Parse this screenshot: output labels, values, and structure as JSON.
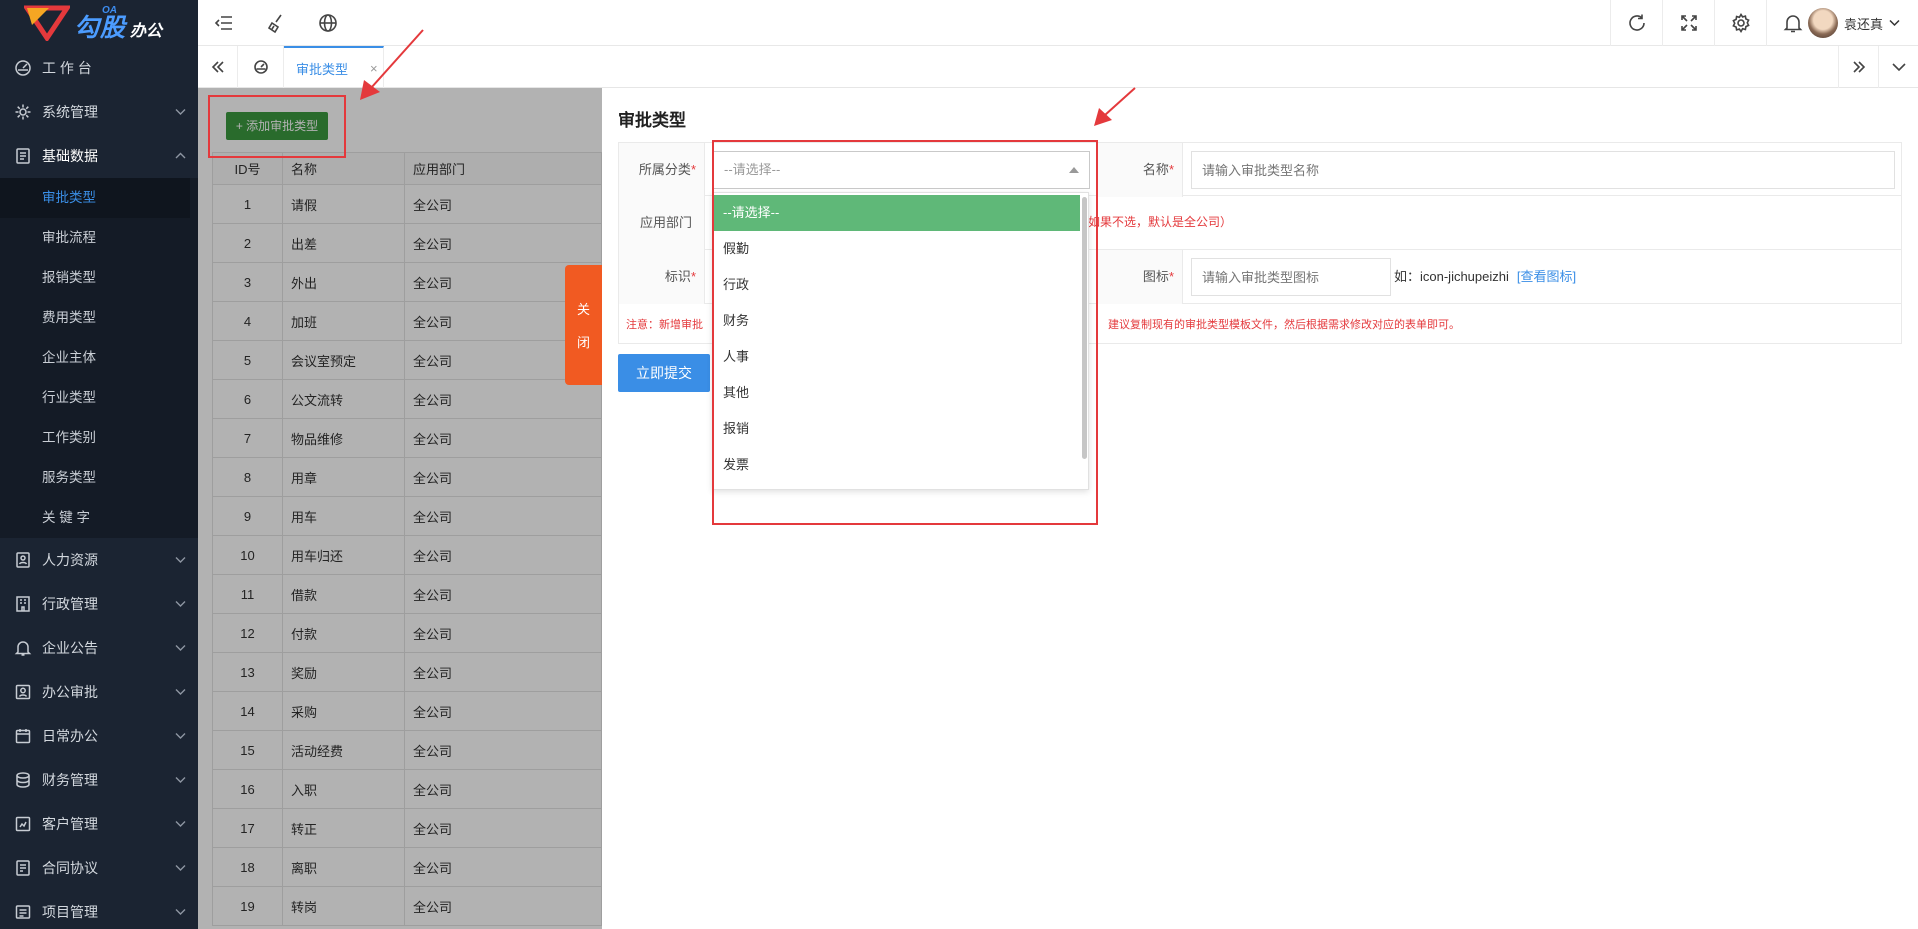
{
  "logo": {
    "oa": "OA",
    "brand": "勾股",
    "suffix": "办公"
  },
  "sidebar": {
    "items": [
      {
        "label": "工 作 台",
        "icon": "dashboard-icon"
      },
      {
        "label": "系统管理",
        "icon": "gear-icon"
      },
      {
        "label": "基础数据",
        "icon": "document-icon"
      },
      {
        "label": "人力资源",
        "icon": "user-badge-icon"
      },
      {
        "label": "行政管理",
        "icon": "building-icon"
      },
      {
        "label": "企业公告",
        "icon": "bell-icon"
      },
      {
        "label": "办公审批",
        "icon": "approval-icon"
      },
      {
        "label": "日常办公",
        "icon": "calendar-icon"
      },
      {
        "label": "财务管理",
        "icon": "database-icon"
      },
      {
        "label": "客户管理",
        "icon": "customer-icon"
      },
      {
        "label": "合同协议",
        "icon": "contract-icon"
      },
      {
        "label": "项目管理",
        "icon": "project-icon"
      }
    ],
    "sub_items": [
      "审批类型",
      "审批流程",
      "报销类型",
      "费用类型",
      "企业主体",
      "行业类型",
      "工作类别",
      "服务类型",
      "关 键 字"
    ]
  },
  "topbar": {
    "user_name": "袁还真"
  },
  "tabs": {
    "active_label": "审批类型",
    "close_glyph": "×"
  },
  "list": {
    "add_button": "+ 添加审批类型",
    "columns": [
      "ID号",
      "名称",
      "应用部门"
    ],
    "rows": [
      [
        "1",
        "请假",
        "全公司"
      ],
      [
        "2",
        "出差",
        "全公司"
      ],
      [
        "3",
        "外出",
        "全公司"
      ],
      [
        "4",
        "加班",
        "全公司"
      ],
      [
        "5",
        "会议室预定",
        "全公司"
      ],
      [
        "6",
        "公文流转",
        "全公司"
      ],
      [
        "7",
        "物品维修",
        "全公司"
      ],
      [
        "8",
        "用章",
        "全公司"
      ],
      [
        "9",
        "用车",
        "全公司"
      ],
      [
        "10",
        "用车归还",
        "全公司"
      ],
      [
        "11",
        "借款",
        "全公司"
      ],
      [
        "12",
        "付款",
        "全公司"
      ],
      [
        "13",
        "奖励",
        "全公司"
      ],
      [
        "14",
        "采购",
        "全公司"
      ],
      [
        "15",
        "活动经费",
        "全公司"
      ],
      [
        "16",
        "入职",
        "全公司"
      ],
      [
        "17",
        "转正",
        "全公司"
      ],
      [
        "18",
        "离职",
        "全公司"
      ],
      [
        "19",
        "转岗",
        "全公司"
      ]
    ]
  },
  "close_tab": {
    "line1": "关",
    "line2": "闭"
  },
  "form": {
    "title": "审批类型",
    "category_label": "所属分类",
    "category_placeholder": "--请选择--",
    "name_label": "名称",
    "name_placeholder": "请输入审批类型名称",
    "dept_label": "应用部门",
    "dept_hint": "如果不选，默认是全公司）",
    "key_label": "标识",
    "icon_label": "图标",
    "icon_placeholder": "请输入审批类型图标",
    "icon_example": "如：icon-jichupeizhi",
    "icon_link": "[查看图标]",
    "required_mark": "*",
    "note_start": "注意：新增审批",
    "note_end": "建议复制现有的审批类型模板文件，然后根据需求修改对应的表单即可。",
    "submit": "立即提交"
  },
  "dropdown": {
    "options": [
      "--请选择--",
      "假勤",
      "行政",
      "财务",
      "人事",
      "其他",
      "报销",
      "发票"
    ],
    "selected_index": 0
  },
  "colors": {
    "sidebar_bg": "#1b2432",
    "accent": "#3a8ee6",
    "add_button": "#3c9a40",
    "close_tab": "#f15a22",
    "selected_option": "#5fb878",
    "annotation_red": "#e4393c"
  }
}
